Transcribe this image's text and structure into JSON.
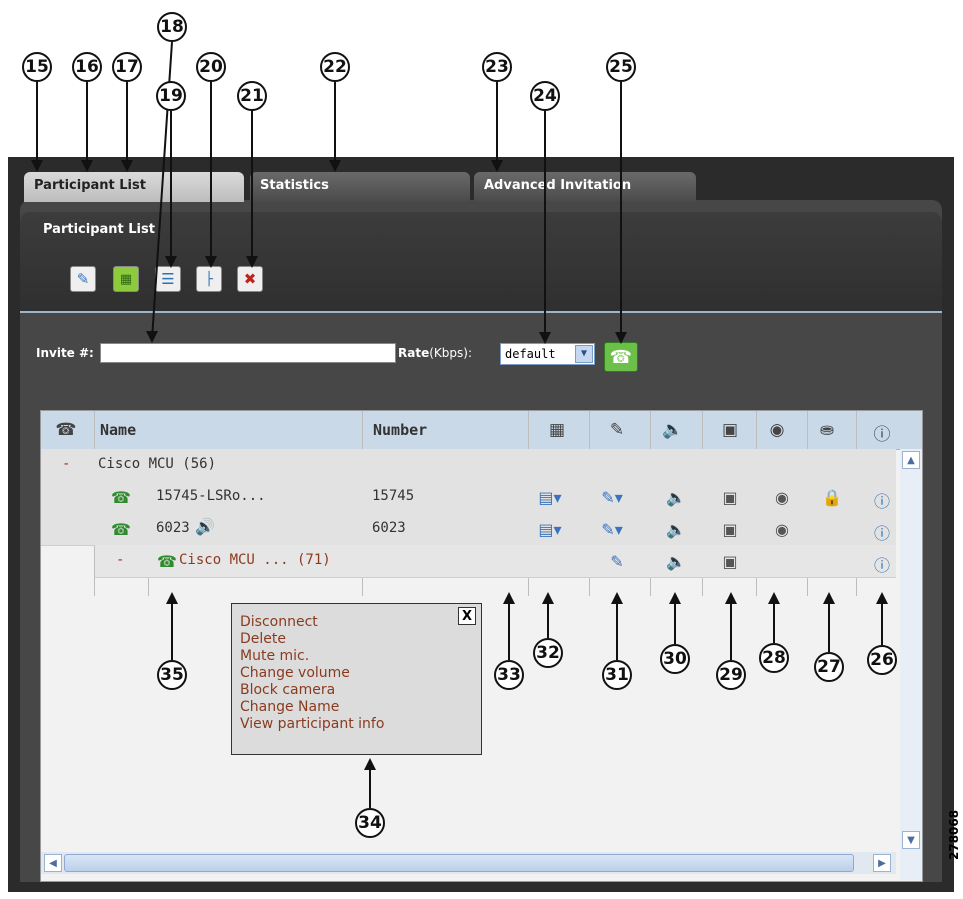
{
  "tabs": [
    {
      "label": "Participant List"
    },
    {
      "label": "Statistics"
    },
    {
      "label": "Advanced Invitation"
    }
  ],
  "panel": {
    "title": "Participant List"
  },
  "toolbar": [
    {
      "icon": "microphone-icon"
    },
    {
      "icon": "layout-grid-icon"
    },
    {
      "icon": "list-view-icon"
    },
    {
      "icon": "tree-view-icon"
    },
    {
      "icon": "remove-participant-icon"
    }
  ],
  "invite": {
    "label": "Invite #:",
    "value": ""
  },
  "rate": {
    "label_bold": "Rate",
    "label_unit": "(Kbps):",
    "selected": "default"
  },
  "table": {
    "headers": {
      "name": "Name",
      "number": "Number"
    },
    "group": {
      "toggle": "-",
      "label": "Cisco MCU (56)"
    },
    "rows": [
      {
        "name": "15745-LSRo...",
        "number": "15745"
      },
      {
        "name": "6023",
        "number": "6023"
      }
    ],
    "nested": {
      "toggle": "-",
      "label": "Cisco MCU ... (71)"
    }
  },
  "context_menu": {
    "close": "X",
    "items": [
      "Disconnect",
      "Delete",
      "Mute mic.",
      "Change volume",
      "Block camera",
      "Change Name",
      "View participant info"
    ]
  },
  "callouts": [
    "15",
    "16",
    "17",
    "18",
    "19",
    "20",
    "21",
    "22",
    "23",
    "24",
    "25",
    "26",
    "27",
    "28",
    "29",
    "30",
    "31",
    "32",
    "33",
    "34",
    "35"
  ],
  "figure_id": "278068",
  "colors": {
    "frame": "#2b2b2b",
    "header": "#c9d9e8",
    "menu_text": "#8a3b1f",
    "call_button": "#6cc04a"
  }
}
